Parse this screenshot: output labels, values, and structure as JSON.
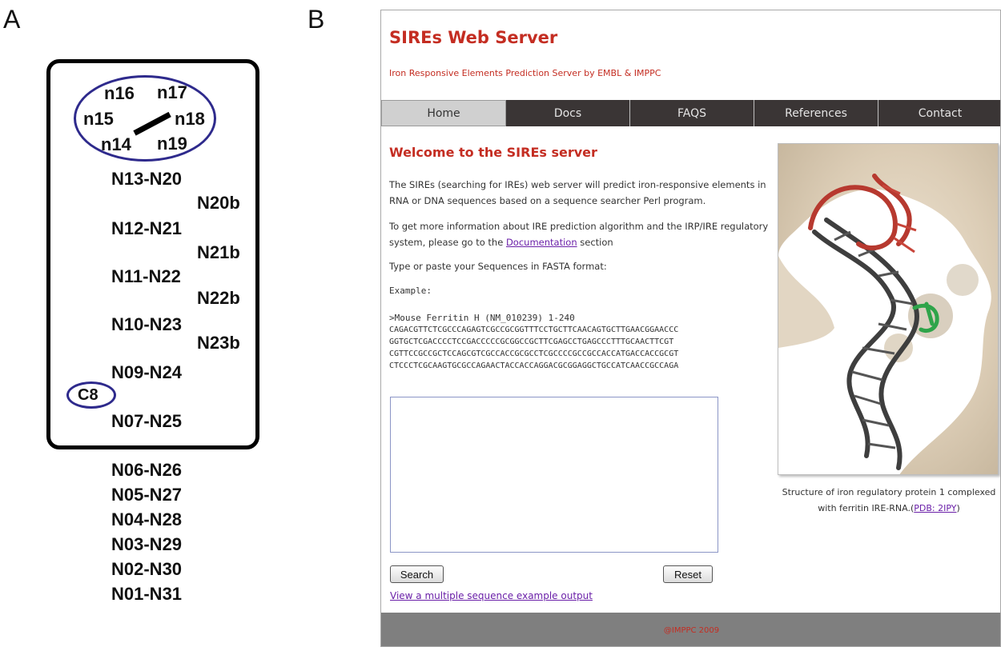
{
  "panel_labels": {
    "a": "A",
    "b": "B"
  },
  "panel_a": {
    "loop": {
      "n16": "n16",
      "n17": "n17",
      "n15": "n15",
      "n18": "n18",
      "n14": "n14",
      "n19": "n19"
    },
    "inner_pairs": [
      "N13-N20",
      "N20b",
      "N12-N21",
      "N21b",
      "N11-N22",
      "N22b",
      "N10-N23",
      "N23b",
      "N09-N24",
      "C8",
      "N07-N25"
    ],
    "outer_pairs": [
      "N06-N26",
      "N05-N27",
      "N04-N28",
      "N03-N29",
      "N02-N30",
      "N01-N31"
    ],
    "colors": {
      "ellipse": "#2e2a8c",
      "box": "#000000"
    }
  },
  "site": {
    "title": "SIREs Web Server",
    "subtitle": "Iron Responsive Elements Prediction Server by EMBL & IMPPC",
    "nav": [
      "Home",
      "Docs",
      "FAQS",
      "References",
      "Contact"
    ],
    "active_nav": "Home",
    "welcome_heading": "Welcome to the SIREs server",
    "intro": "The SIREs (searching for IREs) web server will predict iron-responsive elements in RNA or DNA sequences based on a sequence searcher Perl program.",
    "info_before": "To get more information about IRE prediction algorithm and the IRP/IRE regulatory system, please go to the ",
    "info_link": "Documentation",
    "info_after": " section",
    "paste_prompt": "Type or paste your Sequences in FASTA format:",
    "example_label": "Example:",
    "example_header": ">Mouse Ferritin H (NM_010239) 1-240",
    "example_lines": [
      "CAGACGTTCTCGCCCAGAGTCGCCGCGGTTTCCTGCTTCAACAGTGCTTGAACGGAACCC",
      "GGTGCTCGACCCCTCCGACCCCCGCGGCCGCTTCGAGCCTGAGCCCTTTGCAACTTCGT",
      "CGTTCCGCCGCTCCAGCGTCGCCACCGCGCCTCGCCCCGCCGCCACCATGACCACCGCGT",
      "CTCCCTCGCAAGTGCGCCAGAACTACCACCAGGACGCGGAGGCTGCCATCAACCGCCAGA"
    ],
    "textarea_value": "",
    "search_button": "Search",
    "reset_button": "Reset",
    "multi_link": "View a multiple sequence example output",
    "caption": "Structure of iron regulatory protein 1 complexed with ferritin IRE-RNA.",
    "caption_link": "PDB: 2IPY",
    "footer": "@IMPPC 2009",
    "colors": {
      "accent": "#c42d22",
      "nav_bg": "#3a3535",
      "link": "#6a1fa8",
      "footer_bg": "#7f7f7f"
    }
  }
}
